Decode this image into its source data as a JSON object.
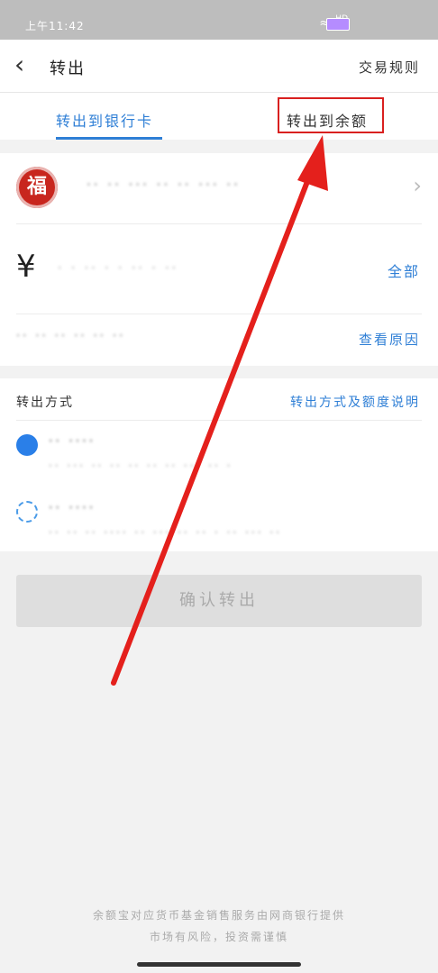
{
  "status_bar": {
    "time": "上午11:42",
    "signal": "HD",
    "signal2": "HD"
  },
  "header": {
    "title": "转出",
    "rules_link": "交易规则",
    "back_icon": "back-chevron-icon"
  },
  "tabs": [
    {
      "label": "转出到银行卡",
      "active": true
    },
    {
      "label": "转出到余额",
      "active": false
    }
  ],
  "bank": {
    "name": "·· ·· ··· ·· ·· ··· ··",
    "seal_text": "福",
    "chevron_icon": "chevron-right-icon"
  },
  "amount": {
    "currency_symbol": "¥",
    "placeholder": "· · ·· · · ·· · ··",
    "all_label": "全部"
  },
  "limit": {
    "note": "·· ·· ·· ·· ·· ··",
    "reason_link": "查看原因"
  },
  "method": {
    "label": "转出方式",
    "info_link": "转出方式及额度说明",
    "options": [
      {
        "title": "·· ····",
        "desc": "·· ··· ·· ·· ·· ·· ·· ··· ·· ·"
      },
      {
        "title": "·· ····",
        "desc": "·· ·· ·· ···· ·· ··· ·· ·· · ·· ··· ··"
      }
    ]
  },
  "confirm_button": "确认转出",
  "footer": {
    "line1": "余额宝对应货币基金销售服务由网商银行提供",
    "line2": "市场有风险，投资需谨慎"
  },
  "colors": {
    "accent": "#2f7fd6",
    "annotation": "#d9201f",
    "seal": "#c8261e"
  }
}
